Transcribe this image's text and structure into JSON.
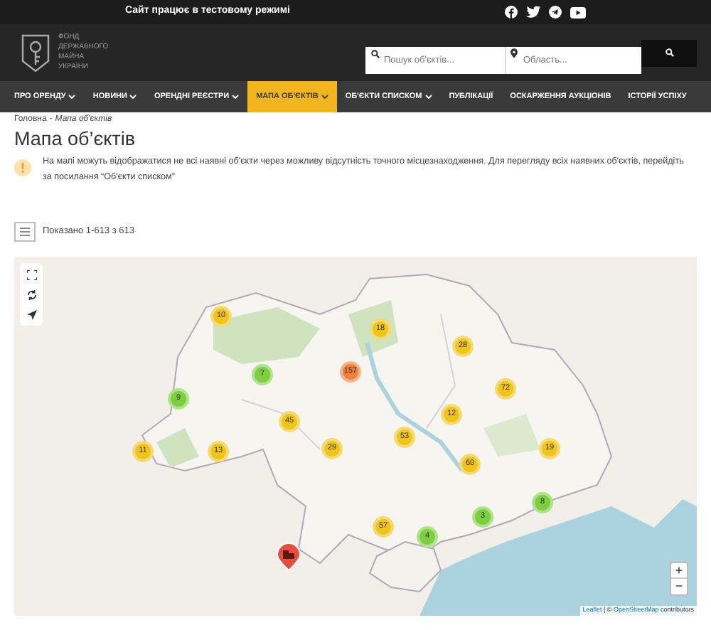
{
  "top_bar": {
    "notice": "Сайт працює в тестовому режимі"
  },
  "logo": {
    "lines": [
      "ФОНД",
      "ДЕРЖАВНОГО",
      "МАЙНА",
      "УКРАЇНИ"
    ]
  },
  "search": {
    "query_placeholder": "Пошук об'єктів...",
    "region_placeholder": "Область..."
  },
  "nav": [
    {
      "label": "ПРО ОРЕНДУ",
      "dropdown": true,
      "selected": false
    },
    {
      "label": "НОВИНИ",
      "dropdown": true,
      "selected": false
    },
    {
      "label": "ОРЕНДНІ РЕЄСТРИ",
      "dropdown": true,
      "selected": false
    },
    {
      "label": "МАПА ОБ'ЄКТІВ",
      "dropdown": true,
      "selected": true
    },
    {
      "label": "ОБ'ЄКТИ СПИСКОМ",
      "dropdown": true,
      "selected": false
    },
    {
      "label": "ПУБЛІКАЦІЇ",
      "dropdown": false,
      "selected": false
    },
    {
      "label": "ОСКАРЖЕННЯ АУКЦІОНІВ",
      "dropdown": false,
      "selected": false
    },
    {
      "label": "ІСТОРІЇ УСПІХУ",
      "dropdown": false,
      "selected": false
    }
  ],
  "breadcrumb": [
    {
      "label": "Головна"
    },
    {
      "label": "Мапа об'єктів"
    }
  ],
  "breadcrumb_separator": "-",
  "title": "Мапа об’єктів",
  "notice": "На мапі можуть відображатися не всі наявні об'єкти через можливу відсутність точного місцезнаходження. Для перегляду всіх наявних об'єктів, перейдіть за посилання “Об'єкти списком”",
  "results": "Показано 1-613 з 613",
  "map": {
    "clusters": [
      {
        "count": "10",
        "color": "#f0c419"
      },
      {
        "count": "7",
        "color": "#7ccf3f"
      },
      {
        "count": "9",
        "color": "#7ccf3f"
      },
      {
        "count": "11",
        "color": "#f0c419"
      },
      {
        "count": "13",
        "color": "#f0c419"
      },
      {
        "count": "45",
        "color": "#f0c419"
      },
      {
        "count": "157",
        "color": "#f0803c"
      },
      {
        "count": "29",
        "color": "#f0c419"
      },
      {
        "count": "18",
        "color": "#f0c419"
      },
      {
        "count": "28",
        "color": "#f0c419"
      },
      {
        "count": "72",
        "color": "#f0c419"
      },
      {
        "count": "12",
        "color": "#f0c419"
      },
      {
        "count": "53",
        "color": "#f0c419"
      },
      {
        "count": "60",
        "color": "#f0c419"
      },
      {
        "count": "19",
        "color": "#f0c419"
      },
      {
        "count": "8",
        "color": "#7ccf3f"
      },
      {
        "count": "3",
        "color": "#7ccf3f"
      },
      {
        "count": "57",
        "color": "#f0c419"
      },
      {
        "count": "4",
        "color": "#7ccf3f"
      }
    ],
    "zoom_in": "+",
    "zoom_out": "−",
    "attribution": [
      {
        "label": "Leaflet",
        "kind": "link"
      },
      {
        "label": " | © ",
        "kind": "text"
      },
      {
        "label": "OpenStreetMap",
        "kind": "link"
      },
      {
        "label": " contributors",
        "kind": "text"
      }
    ]
  }
}
